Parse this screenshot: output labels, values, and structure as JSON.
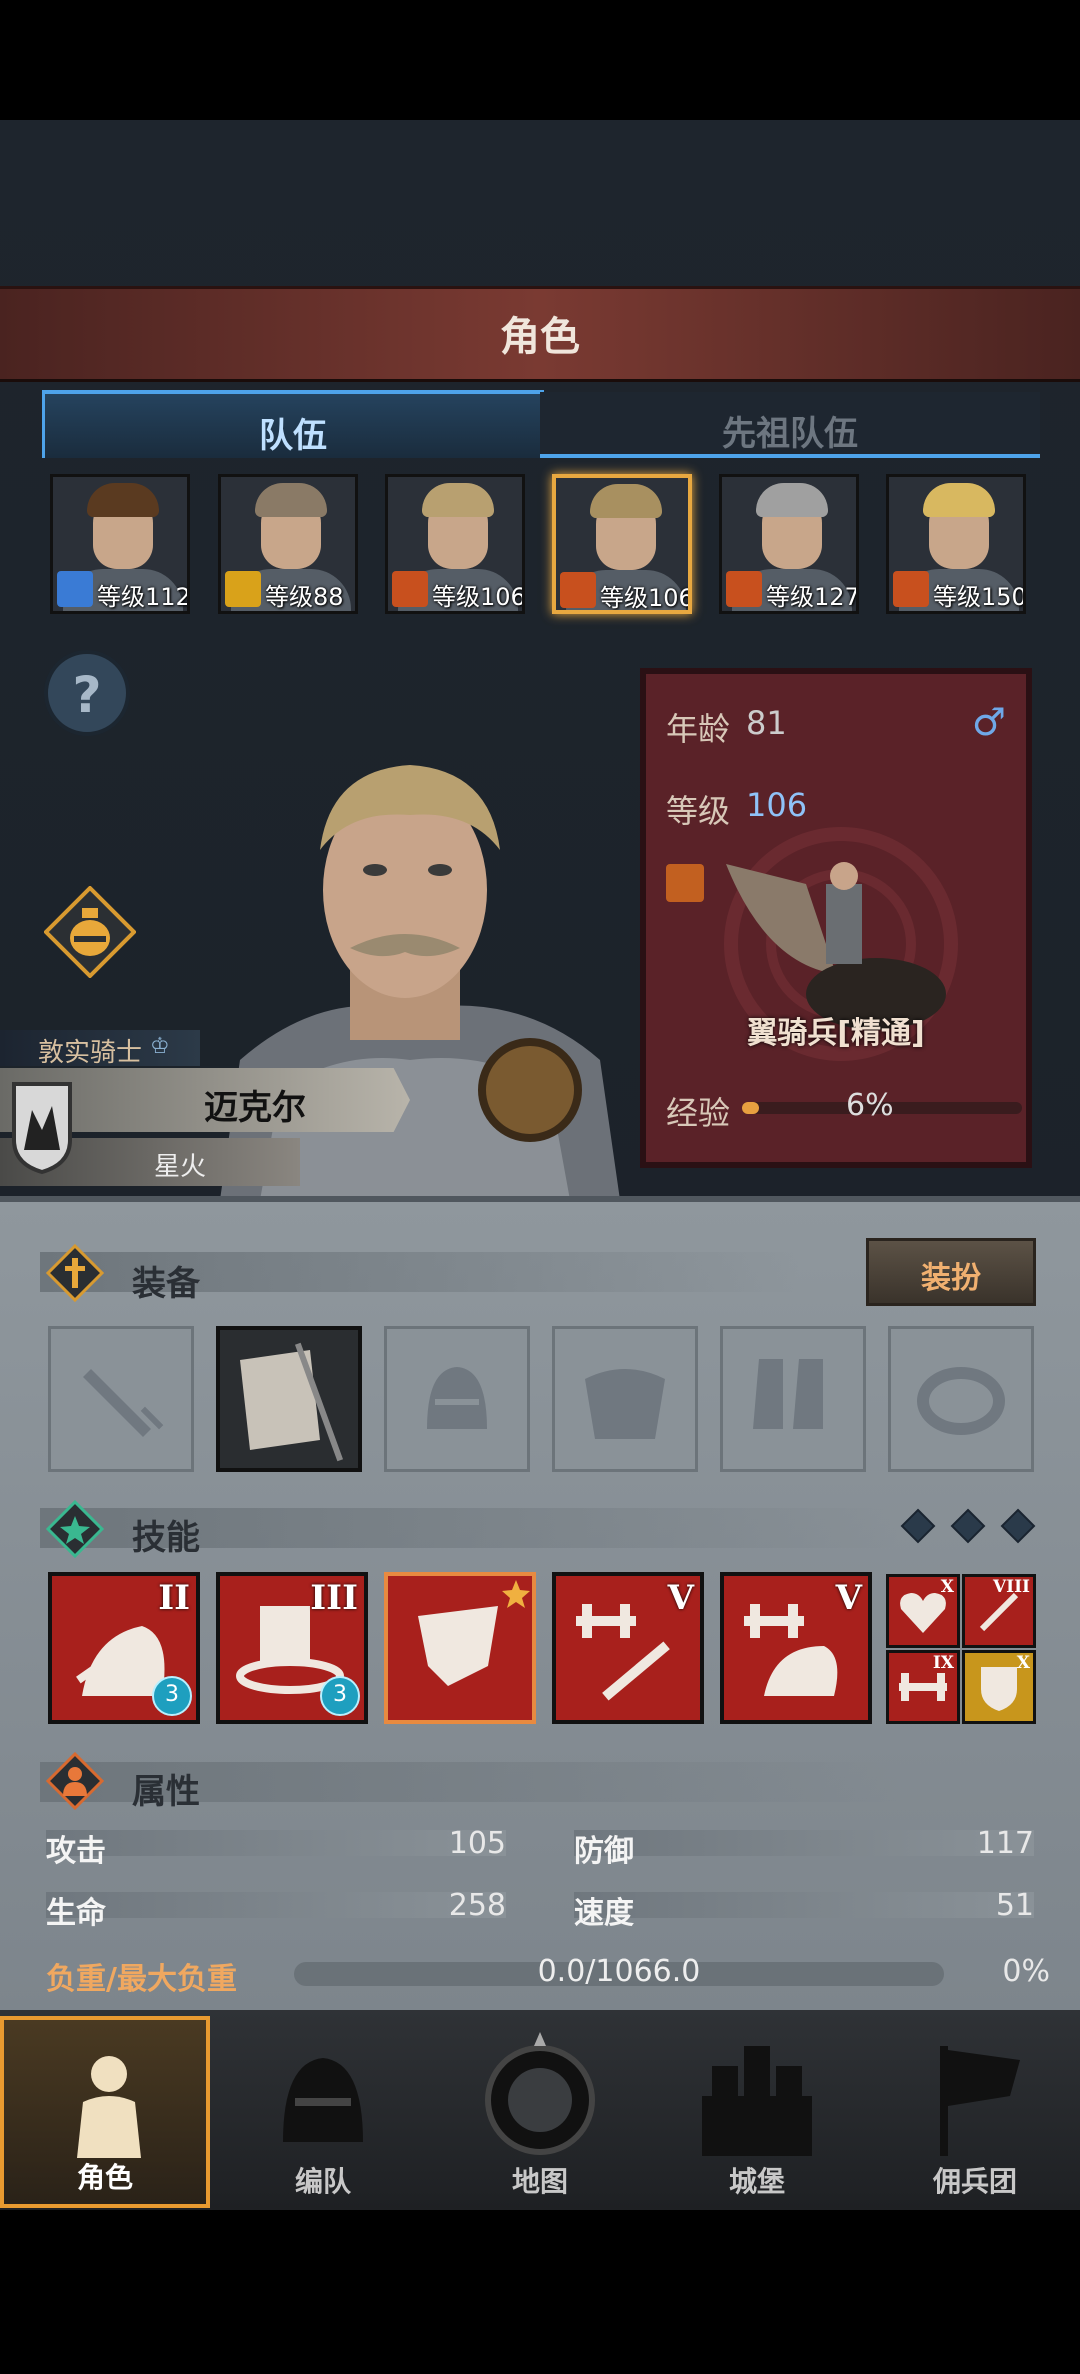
{
  "header": {
    "title": "角色"
  },
  "tabs": {
    "team": "队伍",
    "ancestor_team": "先祖队伍"
  },
  "roster": [
    {
      "level_text": "等级112",
      "class_color": "#3a7bd5",
      "hair": "#5a3a20",
      "selected": false
    },
    {
      "level_text": "等级88",
      "class_color": "#d9a21a",
      "hair": "#8a7a66",
      "selected": false
    },
    {
      "level_text": "等级106",
      "class_color": "#c8501e",
      "hair": "#b8a070",
      "selected": false
    },
    {
      "level_text": "等级106",
      "class_color": "#c8501e",
      "hair": "#a89060",
      "selected": true
    },
    {
      "level_text": "等级127",
      "class_color": "#c8501e",
      "hair": "#a0a0a0",
      "selected": false
    },
    {
      "level_text": "等级150",
      "class_color": "#c8501e",
      "hair": "#d8b860",
      "selected": false
    }
  ],
  "help": {
    "glyph": "?"
  },
  "info": {
    "age_label": "年龄",
    "age_value": "81",
    "gender_glyph": "♂",
    "level_label": "等级",
    "level_value": "106",
    "unit_name": "翼骑兵[精通]",
    "exp_label": "经验",
    "exp_value": "6%",
    "exp_fraction": 0.06
  },
  "hero": {
    "title": "敦实骑士",
    "name": "迈克尔",
    "subname": "星火"
  },
  "equipment": {
    "title": "装备",
    "outfit_button": "装扮"
  },
  "skills": {
    "title": "技能",
    "main": [
      {
        "rank": "II",
        "count": "3"
      },
      {
        "rank": "III",
        "count": "3"
      },
      {
        "rank": "",
        "count": ""
      },
      {
        "rank": "V",
        "count": ""
      },
      {
        "rank": "V",
        "count": ""
      }
    ],
    "mini": [
      {
        "rank": "X",
        "color": "#a8201c"
      },
      {
        "rank": "VIII",
        "color": "#a8201c"
      },
      {
        "rank": "IX",
        "color": "#a8201c"
      },
      {
        "rank": "X",
        "color": "#c8961c"
      }
    ]
  },
  "attributes": {
    "title": "属性",
    "attack_label": "攻击",
    "attack_value": "105",
    "defense_label": "防御",
    "defense_value": "117",
    "health_label": "生命",
    "health_value": "258",
    "speed_label": "速度",
    "speed_value": "51",
    "load_label": "负重/最大负重",
    "load_value": "0.0/1066.0",
    "load_percent": "0%"
  },
  "nav": [
    {
      "label": "角色",
      "icon": "knight-icon",
      "active": true
    },
    {
      "label": "编队",
      "icon": "helmet-icon",
      "active": false
    },
    {
      "label": "地图",
      "icon": "compass-map-icon",
      "active": false
    },
    {
      "label": "城堡",
      "icon": "castle-icon",
      "active": false
    },
    {
      "label": "佣兵团",
      "icon": "mercenary-flag-icon",
      "active": false
    }
  ],
  "colors": {
    "accent_blue": "#4ea3ea",
    "selected_gold": "#e8a840",
    "card_red": "#5a2228"
  }
}
